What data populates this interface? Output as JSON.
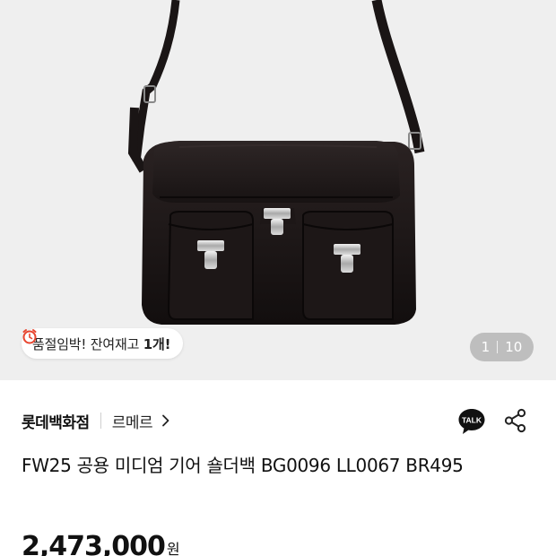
{
  "product_image": {
    "alt": ""
  },
  "stock_notice": {
    "prefix": "품절임박! 잔여재고 ",
    "count": "1개!"
  },
  "pager": {
    "current": "1",
    "total": "10"
  },
  "seller": {
    "store": "롯데백화점",
    "brand": "르메르"
  },
  "actions": {
    "talk_label": "TALK"
  },
  "product": {
    "title": "FW25 공용 미디엄 기어 숄더백 BG0096 LL0067 BR495"
  },
  "price": {
    "amount": "2,473,000",
    "unit": "원"
  },
  "colors": {
    "hero_bg": "#efefef",
    "bag": "#1b1616",
    "stock_clock": "#e8452f",
    "talk_bg": "#111111"
  },
  "icons": {
    "stock": "alarm-clock-icon",
    "brand_link": "chevron-right-icon",
    "talk": "talk-chat-icon",
    "share": "share-icon"
  }
}
